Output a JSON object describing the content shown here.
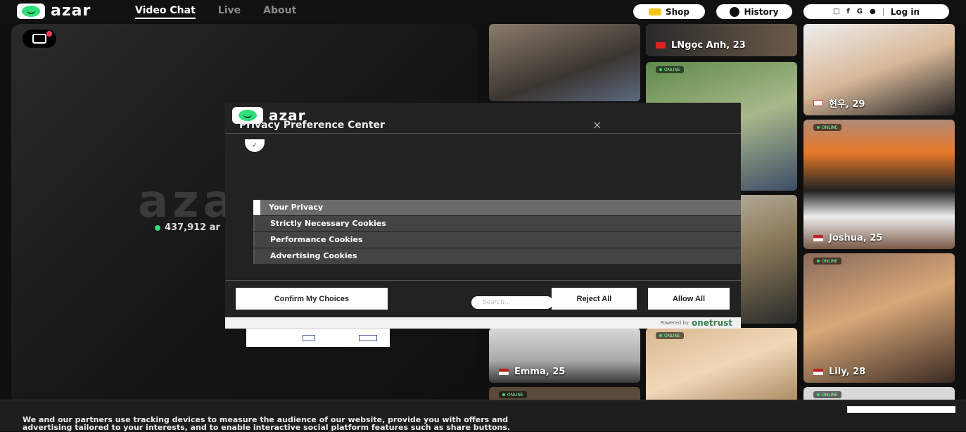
{
  "header": {
    "logo_text": "azar",
    "nav": [
      {
        "label": "Video Chat",
        "active": true
      },
      {
        "label": "Live",
        "active": false
      },
      {
        "label": "About",
        "active": false
      }
    ],
    "shop_label": "Shop",
    "history_label": "History",
    "login_label": "Log in",
    "login_icons": [
      "instagram-icon",
      "facebook-icon",
      "google-icon",
      "apple-icon"
    ]
  },
  "left_panel": {
    "brand_watermark": "azar",
    "online_count": "437,912 ar"
  },
  "profiles": [
    {
      "name": "LNgọc Anh, 23",
      "flag": "vn",
      "online": false
    },
    {
      "name": "현우, 29",
      "flag": "kr",
      "online": false
    },
    {
      "name": "Joshua, 25",
      "flag": "us",
      "online": true
    },
    {
      "name": "Emma, 25",
      "flag": "us",
      "online": false
    },
    {
      "name": "Lily, 28",
      "flag": "us",
      "online": true
    }
  ],
  "online_label": "ONLINE",
  "modal": {
    "logo_text": "azar",
    "title": "Privacy Preference Center",
    "close": "×",
    "menu": [
      {
        "label": "Your Privacy",
        "active": true
      },
      {
        "label": "Strictly Necessary Cookies",
        "active": false
      },
      {
        "label": "Performance Cookies",
        "active": false
      },
      {
        "label": "Advertising Cookies",
        "active": false
      }
    ],
    "confirm_label": "Confirm My Choices",
    "search_placeholder": "Search...",
    "reject_label": "Reject All",
    "allow_label": "Allow All",
    "powered_by": "Powered by",
    "powered_brand": "onetrust"
  },
  "cookie_bar": {
    "text": "We and our partners use tracking devices to measure the audience of our website, provide you with offers and advertising tailored to your interests, and to enable interactive social platform features such as share buttons."
  },
  "colors": {
    "accent_green": "#2fe07b",
    "background": "#0f0f0f",
    "modal_bg": "#222222",
    "onetrust_green": "#3b7d4f"
  }
}
